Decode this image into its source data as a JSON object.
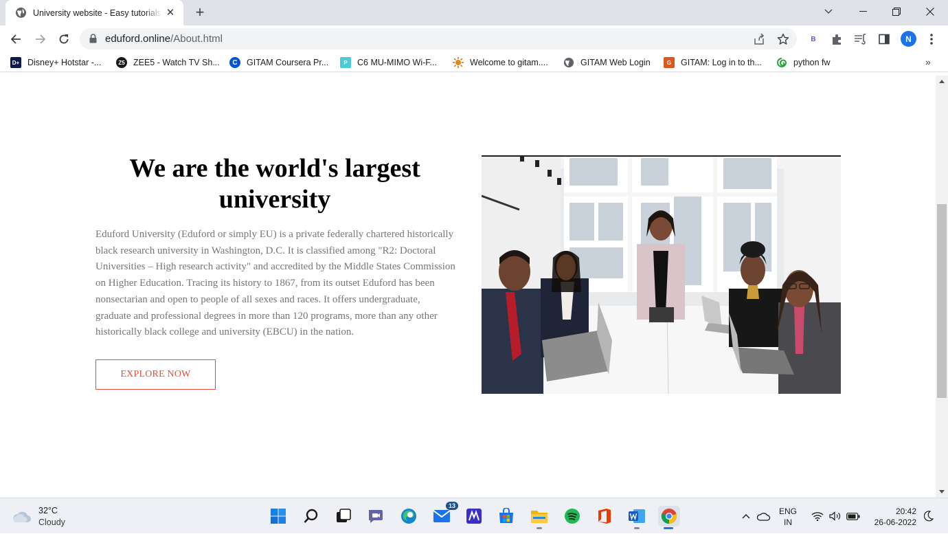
{
  "browser": {
    "tab_title": "University website - Easy tutorials",
    "url_host": "eduford.online",
    "url_path": "/About.html",
    "profile_initial": "N",
    "extension_label": "B"
  },
  "bookmarks": [
    {
      "label": "Disney+ Hotstar -...",
      "icon": "hotstar-icon",
      "color": "#0c1b4a"
    },
    {
      "label": "ZEE5 - Watch TV Sh...",
      "icon": "zee5-icon",
      "color": "#1a1a1a"
    },
    {
      "label": "GITAM Coursera Pr...",
      "icon": "coursera-icon",
      "color": "#0056d2"
    },
    {
      "label": "C6 MU-MIMO Wi-F...",
      "icon": "tplink-icon",
      "color": "#4acbd6"
    },
    {
      "label": "Welcome to gitam....",
      "icon": "gitam-sun-icon",
      "color": "#e08a1e"
    },
    {
      "label": "GITAM Web Login",
      "icon": "globe-icon",
      "color": "#5f6368"
    },
    {
      "label": "GITAM: Log in to th...",
      "icon": "gitam-logo-icon",
      "color": "#d9591f"
    },
    {
      "label": "python fw",
      "icon": "python-fw-icon",
      "color": "#2ea043"
    }
  ],
  "about": {
    "title": "We are the world's largest university",
    "paragraph": "Eduford University (Eduford or simply EU) is a private federally chartered historically black research university in Washington, D.C. It is classified among \"R2: Doctoral Universities – High research activity\" and accredited by the Middle States Commission on Higher Education. Tracing its history to 1867, from its outset Eduford has been nonsectarian and open to people of all sexes and races. It offers undergraduate, graduate and professional degrees in more than 120 programs, more than any other historically black college and university (EBCU) in the nation.",
    "button_label": "EXPLORE NOW",
    "accent_color": "#e74c3c"
  },
  "taskbar": {
    "weather_temp": "32°C",
    "weather_condition": "Cloudy",
    "mail_badge": "13",
    "lang_line1": "ENG",
    "lang_line2": "IN",
    "time": "20:42",
    "date": "26-06-2022"
  }
}
